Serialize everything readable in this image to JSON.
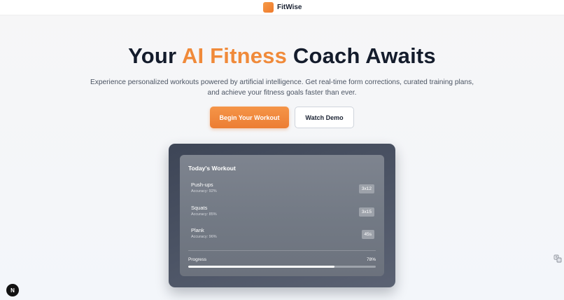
{
  "brand": {
    "name": "FitWise",
    "logo_color": "#ef7a2c"
  },
  "hero": {
    "title_prefix": "Your ",
    "title_accent": "AI Fitness",
    "title_suffix": " Coach Awaits",
    "accent_color": "#f08a3a",
    "subtitle": "Experience personalized workouts powered by artificial intelligence. Get real-time form corrections, curated training plans, and achieve your fitness goals faster than ever."
  },
  "actions": {
    "primary_label": "Begin Your Workout",
    "secondary_label": "Watch Demo"
  },
  "workout": {
    "title": "Today's Workout",
    "exercises": [
      {
        "name": "Push-ups",
        "accuracy": "Accuracy: 92%",
        "sets": "3x12"
      },
      {
        "name": "Squats",
        "accuracy": "Accuracy: 85%",
        "sets": "3x15"
      },
      {
        "name": "Plank",
        "accuracy": "Accuracy: 96%",
        "sets": "45s"
      }
    ],
    "progress_label": "Progress",
    "progress_text": "78%",
    "progress_fraction": 0.78
  },
  "dev_badge": {
    "letter": "N"
  },
  "icons": {
    "side": "translate-icon",
    "dev": "next-logo-icon"
  }
}
